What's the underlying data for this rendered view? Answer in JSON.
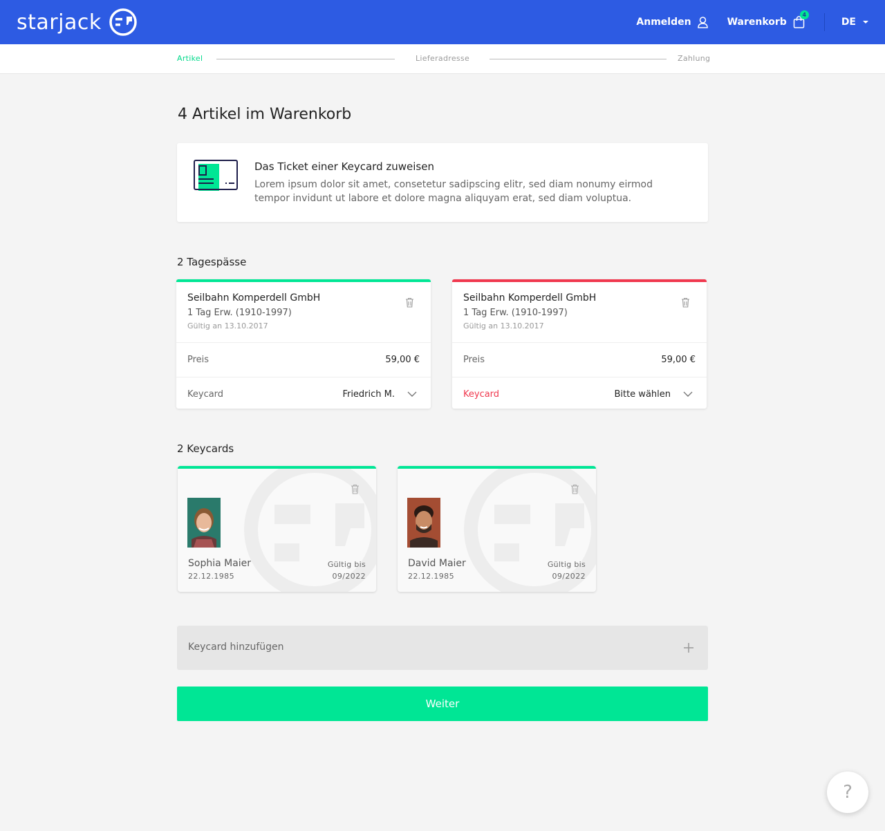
{
  "header": {
    "logo_text": "starjack",
    "login_label": "Anmelden",
    "cart_label": "Warenkorb",
    "cart_count": "4",
    "language": "DE",
    "brand_color": "#2d5be3",
    "accent_color": "#00e695"
  },
  "stepper": {
    "steps": [
      {
        "label": "Artikel",
        "active": true
      },
      {
        "label": "Lieferadresse",
        "active": false
      },
      {
        "label": "Zahlung",
        "active": false
      }
    ]
  },
  "main": {
    "title": "4 Artikel im Warenkorb",
    "info": {
      "icon": "keycard-icon",
      "title": "Das Ticket einer Keycard zuweisen",
      "text": "Lorem ipsum dolor sit amet, consetetur sadipscing elitr, sed diam nonumy eirmod tempor invidunt ut labore et dolore magna aliquyam erat, sed diam voluptua."
    },
    "tickets_section_title": "2 Tagespässe",
    "tickets": [
      {
        "name": "Seilbahn Komperdell GmbH",
        "type": "1 Tag Erw. (1910-1997)",
        "valid": "Gültig an 13.10.2017",
        "price_label": "Preis",
        "price": "59,00 €",
        "keycard_label": "Keycard",
        "keycard_value": "Friedrich M.",
        "status_color": "#00e695"
      },
      {
        "name": "Seilbahn Komperdell GmbH",
        "type": "1 Tag Erw. (1910-1997)",
        "valid": "Gültig an 13.10.2017",
        "price_label": "Preis",
        "price": "59,00 €",
        "keycard_label": "Keycard",
        "keycard_value": "Bitte wählen",
        "status_color": "#f0384e"
      }
    ],
    "keycards_section_title": "2 Keycards",
    "keycards": [
      {
        "name": "Sophia Maier",
        "dob": "22.12.1985",
        "valid_label": "Gültig bis",
        "valid_date": "09/2022"
      },
      {
        "name": "David Maier",
        "dob": "22.12.1985",
        "valid_label": "Gültig bis",
        "valid_date": "09/2022"
      }
    ],
    "add_keycard_label": "Keycard hinzufügen",
    "next_label": "Weiter"
  },
  "help": {
    "label": "?"
  }
}
